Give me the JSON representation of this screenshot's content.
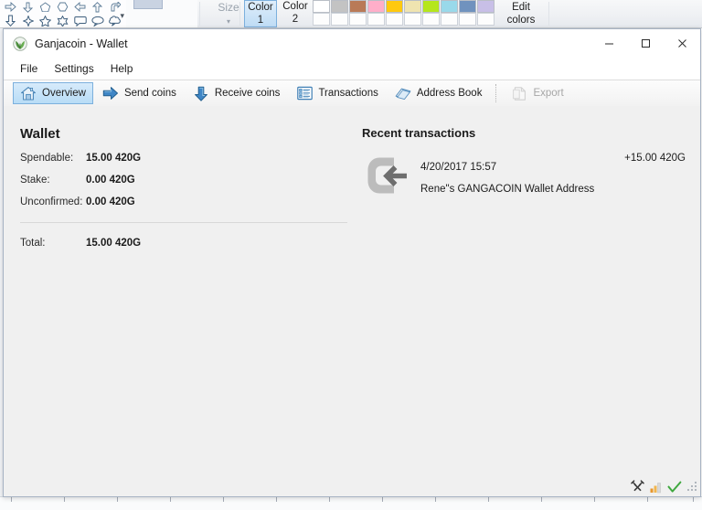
{
  "background_app": {
    "name": "paint-ribbon",
    "shapes_gallery": {
      "row1_icons": [
        "arrow-right-shape",
        "arrow-down-shape",
        "pentagon-shape",
        "hexagon-shape",
        "arrow-left-shape",
        "arrow-up-shape",
        "arrow-curved-shape"
      ],
      "row2_icons": [
        "arrow-down-block-shape",
        "four-point-star-shape",
        "five-point-star-shape",
        "six-point-star-shape",
        "callout-rounded-shape",
        "callout-oval-shape",
        "callout-cloud-shape"
      ],
      "more_label": "▾"
    },
    "size": {
      "label": "Size",
      "caret": "▾"
    },
    "color1": {
      "label_line1": "Color",
      "label_line2": "1",
      "selected": true
    },
    "color2": {
      "label_line1": "Color",
      "label_line2": "2",
      "selected": false
    },
    "edit_colors": {
      "line1": "Edit",
      "line2": "colors"
    },
    "palette_row1": [
      "#ffffff",
      "#c3c3c3",
      "#b97a57",
      "#ffaec9",
      "#ffc90e",
      "#efe4b0",
      "#b5e61d",
      "#99d9ea",
      "#7092be",
      "#c8bfe7"
    ],
    "palette_row2": [
      "#fdfdfd",
      "#fdfdfd",
      "#fdfdfd",
      "#fdfdfd",
      "#fdfdfd",
      "#fdfdfd",
      "#fdfdfd",
      "#fdfdfd",
      "#fdfdfd",
      "#fdfdfd"
    ]
  },
  "window": {
    "title": "Ganjacoin - Wallet",
    "icon": "leaf-icon",
    "controls": {
      "minimize": "—",
      "maximize": "☐",
      "close": "✕"
    }
  },
  "menubar": {
    "items": [
      {
        "label": "File"
      },
      {
        "label": "Settings"
      },
      {
        "label": "Help"
      }
    ]
  },
  "toolbar": {
    "items": [
      {
        "label": "Overview",
        "icon": "house-icon",
        "active": true,
        "disabled": false
      },
      {
        "label": "Send coins",
        "icon": "arrow-right-icon",
        "active": false,
        "disabled": false
      },
      {
        "label": "Receive coins",
        "icon": "arrow-down-icon",
        "active": false,
        "disabled": false
      },
      {
        "label": "Transactions",
        "icon": "list-icon",
        "active": false,
        "disabled": false
      },
      {
        "label": "Address Book",
        "icon": "book-icon",
        "active": false,
        "disabled": false
      },
      {
        "label": "Export",
        "icon": "export-page-icon",
        "active": false,
        "disabled": true
      }
    ]
  },
  "wallet_panel": {
    "title": "Wallet",
    "rows": [
      {
        "label": "Spendable:",
        "value": "15.00 420G"
      },
      {
        "label": "Stake:",
        "value": "0.00 420G"
      },
      {
        "label": "Unconfirmed:",
        "value": "0.00 420G"
      }
    ],
    "total": {
      "label": "Total:",
      "value": "15.00 420G"
    }
  },
  "recent_transactions": {
    "title": "Recent transactions",
    "items": [
      {
        "icon": "incoming-transaction-icon",
        "date": "4/20/2017 15:57",
        "address": "Rene\"s GANGACOIN Wallet Address",
        "amount": "+15.00 420G"
      }
    ]
  },
  "statusbar": {
    "icons": [
      {
        "name": "mining-tools-icon"
      },
      {
        "name": "network-signal-icon"
      },
      {
        "name": "sync-check-icon"
      }
    ],
    "grip": "resize-grip"
  },
  "colors": {
    "accent": "#7cb0dd",
    "tab_active_bg": "#b8dcf6",
    "window_bg": "#f0f0f0",
    "title_bg": "#ffffff",
    "text": "#1b1b1b",
    "disabled_text": "#a6a6a6",
    "tx_icon_gray": "#b8b8b8",
    "tx_arrow_gray": "#6e6e6e",
    "check_green": "#3fa83f"
  }
}
